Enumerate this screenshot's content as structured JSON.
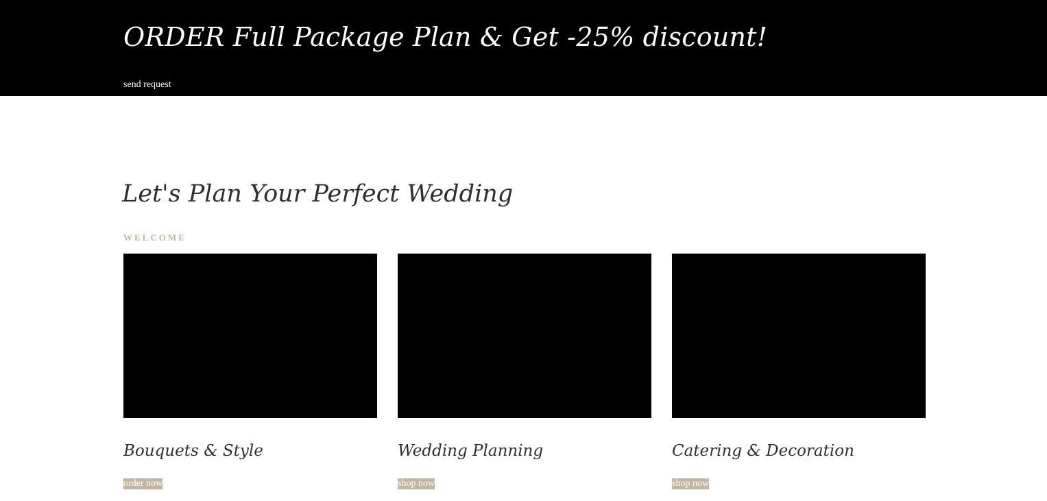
{
  "promo": {
    "title": "ORDER Full Package Plan & Get -25% discount!",
    "link": "send request"
  },
  "intro": {
    "title": "Let's Plan Your Perfect Wedding",
    "kicker": "WELCOME"
  },
  "cards": [
    {
      "title": "Bouquets & Style",
      "action": "order now"
    },
    {
      "title": "Wedding Planning",
      "action": "shop now"
    },
    {
      "title": "Catering & Decoration",
      "action": "shop now"
    }
  ],
  "colors": {
    "banner_background": "#000000",
    "accent": "#c4b4a2",
    "heading": "#2f2f2f",
    "image_placeholder": "#000000"
  }
}
